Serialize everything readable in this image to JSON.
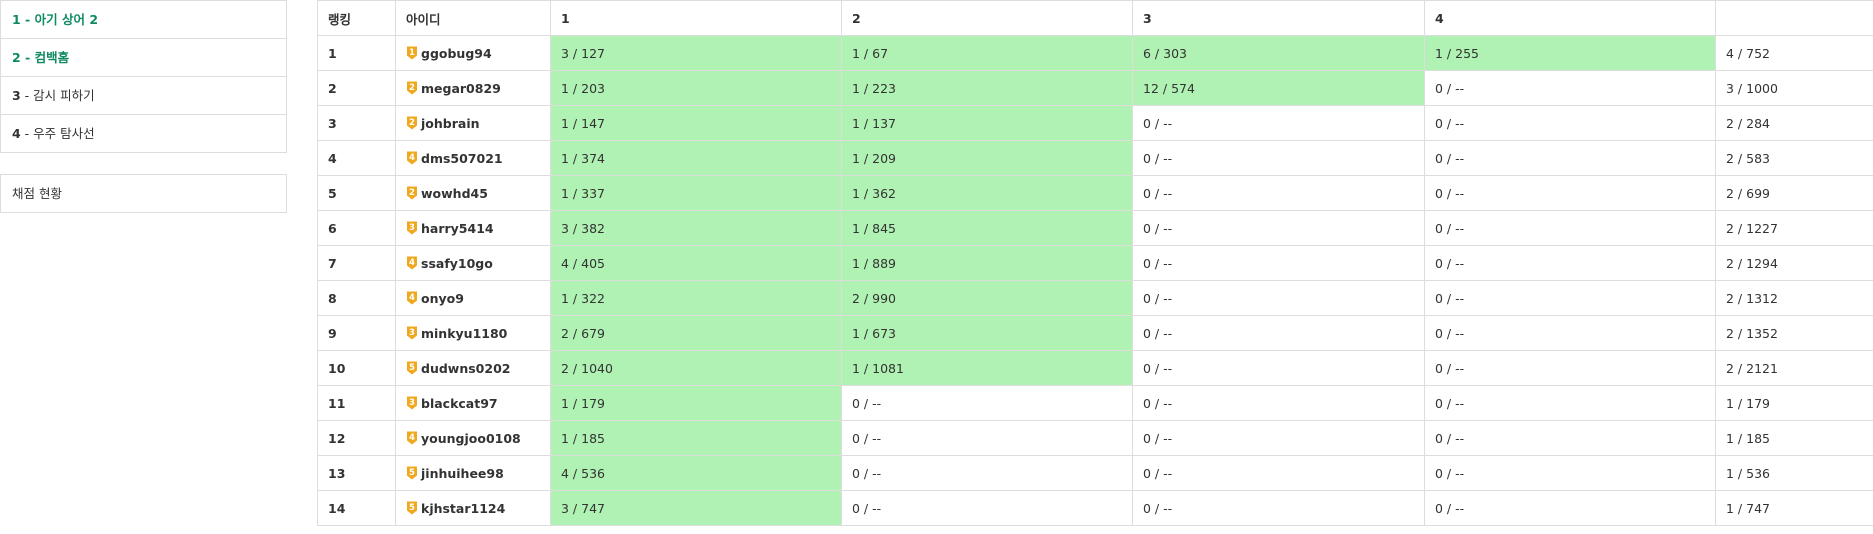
{
  "sidebar": {
    "problems": [
      {
        "num": "1",
        "title": "아기 상어 2",
        "active": true
      },
      {
        "num": "2",
        "title": "컴백홈",
        "active": true
      },
      {
        "num": "3",
        "title": "감시 피하기",
        "active": false
      },
      {
        "num": "4",
        "title": "우주 탐사선",
        "active": false
      }
    ],
    "status_label": "채점 현황"
  },
  "table": {
    "headers": [
      "랭킹",
      "아이디",
      "1",
      "2",
      "3",
      "4",
      ""
    ],
    "rows": [
      {
        "rank": "1",
        "tier": "1",
        "user": "ggobug94",
        "cells": [
          "3 / 127",
          "1 / 67",
          "6 / 303",
          "1 / 255"
        ],
        "solved": [
          true,
          true,
          true,
          true
        ],
        "total": "4 / 752"
      },
      {
        "rank": "2",
        "tier": "2",
        "user": "megar0829",
        "cells": [
          "1 / 203",
          "1 / 223",
          "12 / 574",
          "0 / --"
        ],
        "solved": [
          true,
          true,
          true,
          false
        ],
        "total": "3 / 1000"
      },
      {
        "rank": "3",
        "tier": "2",
        "user": "johbrain",
        "cells": [
          "1 / 147",
          "1 / 137",
          "0 / --",
          "0 / --"
        ],
        "solved": [
          true,
          true,
          false,
          false
        ],
        "total": "2 / 284"
      },
      {
        "rank": "4",
        "tier": "4",
        "user": "dms507021",
        "cells": [
          "1 / 374",
          "1 / 209",
          "0 / --",
          "0 / --"
        ],
        "solved": [
          true,
          true,
          false,
          false
        ],
        "total": "2 / 583"
      },
      {
        "rank": "5",
        "tier": "2",
        "user": "wowhd45",
        "cells": [
          "1 / 337",
          "1 / 362",
          "0 / --",
          "0 / --"
        ],
        "solved": [
          true,
          true,
          false,
          false
        ],
        "total": "2 / 699"
      },
      {
        "rank": "6",
        "tier": "3",
        "user": "harry5414",
        "cells": [
          "3 / 382",
          "1 / 845",
          "0 / --",
          "0 / --"
        ],
        "solved": [
          true,
          true,
          false,
          false
        ],
        "total": "2 / 1227"
      },
      {
        "rank": "7",
        "tier": "4",
        "user": "ssafy10go",
        "cells": [
          "4 / 405",
          "1 / 889",
          "0 / --",
          "0 / --"
        ],
        "solved": [
          true,
          true,
          false,
          false
        ],
        "total": "2 / 1294"
      },
      {
        "rank": "8",
        "tier": "4",
        "user": "onyo9",
        "cells": [
          "1 / 322",
          "2 / 990",
          "0 / --",
          "0 / --"
        ],
        "solved": [
          true,
          true,
          false,
          false
        ],
        "total": "2 / 1312"
      },
      {
        "rank": "9",
        "tier": "3",
        "user": "minkyu1180",
        "cells": [
          "2 / 679",
          "1 / 673",
          "0 / --",
          "0 / --"
        ],
        "solved": [
          true,
          true,
          false,
          false
        ],
        "total": "2 / 1352"
      },
      {
        "rank": "10",
        "tier": "5",
        "user": "dudwns0202",
        "cells": [
          "2 / 1040",
          "1 / 1081",
          "0 / --",
          "0 / --"
        ],
        "solved": [
          true,
          true,
          false,
          false
        ],
        "total": "2 / 2121"
      },
      {
        "rank": "11",
        "tier": "3",
        "user": "blackcat97",
        "cells": [
          "1 / 179",
          "0 / --",
          "0 / --",
          "0 / --"
        ],
        "solved": [
          true,
          false,
          false,
          false
        ],
        "total": "1 / 179"
      },
      {
        "rank": "12",
        "tier": "4",
        "user": "youngjoo0108",
        "cells": [
          "1 / 185",
          "0 / --",
          "0 / --",
          "0 / --"
        ],
        "solved": [
          true,
          false,
          false,
          false
        ],
        "total": "1 / 185"
      },
      {
        "rank": "13",
        "tier": "5",
        "user": "jinhuihee98",
        "cells": [
          "4 / 536",
          "0 / --",
          "0 / --",
          "0 / --"
        ],
        "solved": [
          true,
          false,
          false,
          false
        ],
        "total": "1 / 536"
      },
      {
        "rank": "14",
        "tier": "5",
        "user": "kjhstar1124",
        "cells": [
          "3 / 747",
          "0 / --",
          "0 / --",
          "0 / --"
        ],
        "solved": [
          true,
          false,
          false,
          false
        ],
        "total": "1 / 747"
      }
    ]
  },
  "colors": {
    "solved_bg": "#b0f2b4",
    "active_link": "#0f8a63",
    "tier_badge": "#f0a81e",
    "border": "#dddddd"
  },
  "icons": {
    "tier_badge": "gold-tier-badge-icon"
  }
}
